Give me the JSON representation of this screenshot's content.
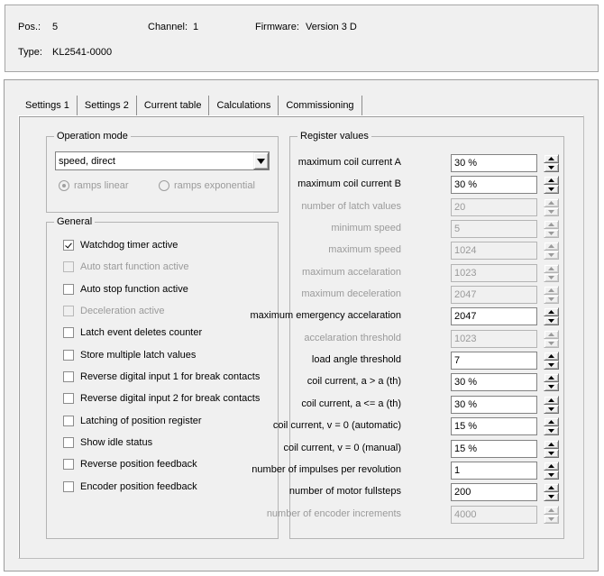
{
  "header": {
    "pos_label": "Pos.:",
    "pos_value": "5",
    "channel_label": "Channel:",
    "channel_value": "1",
    "firmware_label": "Firmware:",
    "firmware_value": "Version 3 D",
    "type_label": "Type:",
    "type_value": "KL2541-0000"
  },
  "tabs": [
    {
      "label": "Settings 1",
      "active": true
    },
    {
      "label": "Settings 2",
      "active": false
    },
    {
      "label": "Current table",
      "active": false
    },
    {
      "label": "Calculations",
      "active": false
    },
    {
      "label": "Commissioning",
      "active": false
    }
  ],
  "operation_mode": {
    "title": "Operation mode",
    "combo_value": "speed, direct",
    "combo_icon": "chevron-down-icon",
    "radios": [
      {
        "label": "ramps linear",
        "checked": true,
        "disabled": true
      },
      {
        "label": "ramps exponential",
        "checked": false,
        "disabled": true
      }
    ]
  },
  "general": {
    "title": "General",
    "checkboxes": [
      {
        "label": "Watchdog timer active",
        "checked": true,
        "disabled": false
      },
      {
        "label": "Auto start function active",
        "checked": false,
        "disabled": true
      },
      {
        "label": "Auto stop function active",
        "checked": false,
        "disabled": false
      },
      {
        "label": "Deceleration active",
        "checked": false,
        "disabled": true
      },
      {
        "label": "Latch event deletes counter",
        "checked": false,
        "disabled": false
      },
      {
        "label": "Store multiple latch values",
        "checked": false,
        "disabled": false
      },
      {
        "label": "Reverse digital input 1 for break contacts",
        "checked": false,
        "disabled": false
      },
      {
        "label": "Reverse digital input 2 for break contacts",
        "checked": false,
        "disabled": false
      },
      {
        "label": "Latching of position register",
        "checked": false,
        "disabled": false
      },
      {
        "label": "Show idle status",
        "checked": false,
        "disabled": false
      },
      {
        "label": "Reverse position feedback",
        "checked": false,
        "disabled": false
      },
      {
        "label": "Encoder position feedback",
        "checked": false,
        "disabled": false
      }
    ]
  },
  "register_values": {
    "title": "Register values",
    "rows": [
      {
        "label": "maximum coil current A",
        "value": "30 %",
        "disabled": false
      },
      {
        "label": "maximum coil current B",
        "value": "30 %",
        "disabled": false
      },
      {
        "label": "number of latch values",
        "value": "20",
        "disabled": true
      },
      {
        "label": "minimum speed",
        "value": "5",
        "disabled": true
      },
      {
        "label": "maximum speed",
        "value": "1024",
        "disabled": true
      },
      {
        "label": "maximum accelaration",
        "value": "1023",
        "disabled": true
      },
      {
        "label": "maximum deceleration",
        "value": "2047",
        "disabled": true
      },
      {
        "label": "maximum emergency accelaration",
        "value": "2047",
        "disabled": false
      },
      {
        "label": "accelaration threshold",
        "value": "1023",
        "disabled": true
      },
      {
        "label": "load angle threshold",
        "value": "7",
        "disabled": false
      },
      {
        "label": "coil current, a > a (th)",
        "value": "30 %",
        "disabled": false
      },
      {
        "label": "coil current, a <= a (th)",
        "value": "30 %",
        "disabled": false
      },
      {
        "label": "coil current, v = 0 (automatic)",
        "value": "15 %",
        "disabled": false
      },
      {
        "label": "coil current, v = 0 (manual)",
        "value": "15 %",
        "disabled": false
      },
      {
        "label": "number of impulses per revolution",
        "value": "1",
        "disabled": false
      },
      {
        "label": "number of motor fullsteps",
        "value": "200",
        "disabled": false
      },
      {
        "label": "number of encoder increments",
        "value": "4000",
        "disabled": true
      }
    ],
    "spinner_up_icon": "spinner-up-icon",
    "spinner_down_icon": "spinner-down-icon"
  },
  "colors": {
    "window_bg": "#f0f0f0",
    "field_bg": "#ffffff",
    "disabled_text": "#9a9a9a",
    "border": "#828282"
  }
}
